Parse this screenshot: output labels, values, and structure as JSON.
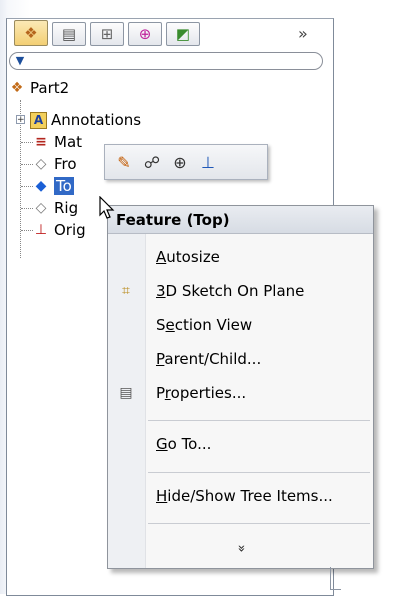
{
  "toolbar": {
    "tabs": [
      {
        "name": "feature-manager-tab",
        "icon": "part-icon"
      },
      {
        "name": "property-manager-tab",
        "icon": "property-icon"
      },
      {
        "name": "configuration-manager-tab",
        "icon": "configuration-icon"
      },
      {
        "name": "dim-xpert-tab",
        "icon": "dimxpert-icon"
      },
      {
        "name": "display-manager-tab",
        "icon": "display-icon"
      }
    ],
    "overflow_glyph": "»"
  },
  "tree": {
    "root": "Part2",
    "items": [
      {
        "label": "Annotations"
      },
      {
        "label": "Mat"
      },
      {
        "label": "Fro"
      },
      {
        "label": "To"
      },
      {
        "label": "Rig"
      },
      {
        "label": "Orig"
      }
    ]
  },
  "context_menu": {
    "title": "Feature (Top)",
    "items": [
      {
        "key": "autosize",
        "pre": "",
        "ul": "A",
        "post": "utosize"
      },
      {
        "key": "sketch3d",
        "pre": "",
        "ul": "3",
        "post": "D Sketch On Plane"
      },
      {
        "key": "section",
        "pre": "S",
        "ul": "e",
        "post": "ction View"
      },
      {
        "key": "parent",
        "pre": "",
        "ul": "P",
        "post": "arent/Child..."
      },
      {
        "key": "properties",
        "pre": "P",
        "ul": "r",
        "post": "operties..."
      },
      {
        "key": "goto",
        "pre": "",
        "ul": "G",
        "post": "o To..."
      },
      {
        "key": "hideshow",
        "pre": "",
        "ul": "H",
        "post": "ide/Show Tree Items..."
      }
    ],
    "more_glyph": "»"
  }
}
